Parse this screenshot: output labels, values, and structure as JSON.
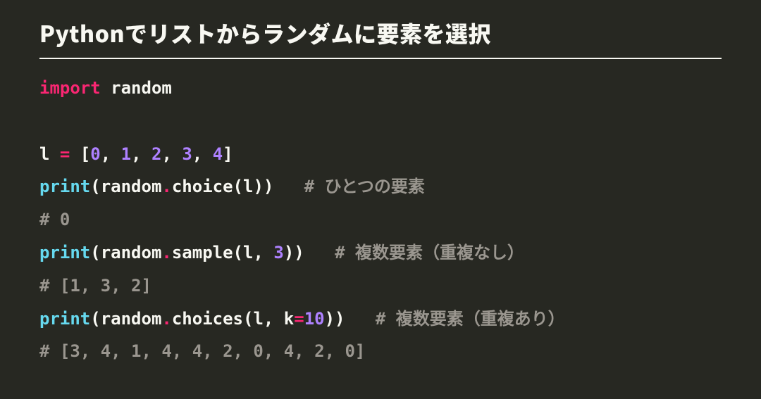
{
  "title": "Pythonでリストからランダムに要素を選択",
  "code": {
    "lines": [
      {
        "type": "tokens",
        "tokens": [
          {
            "cls": "tok-kw",
            "t": "import"
          },
          {
            "cls": "tok-txt",
            "t": " random"
          }
        ]
      },
      {
        "type": "blank"
      },
      {
        "type": "tokens",
        "tokens": [
          {
            "cls": "tok-txt",
            "t": "l "
          },
          {
            "cls": "tok-op",
            "t": "="
          },
          {
            "cls": "tok-txt",
            "t": " ["
          },
          {
            "cls": "tok-num",
            "t": "0"
          },
          {
            "cls": "tok-txt",
            "t": ", "
          },
          {
            "cls": "tok-num",
            "t": "1"
          },
          {
            "cls": "tok-txt",
            "t": ", "
          },
          {
            "cls": "tok-num",
            "t": "2"
          },
          {
            "cls": "tok-txt",
            "t": ", "
          },
          {
            "cls": "tok-num",
            "t": "3"
          },
          {
            "cls": "tok-txt",
            "t": ", "
          },
          {
            "cls": "tok-num",
            "t": "4"
          },
          {
            "cls": "tok-txt",
            "t": "]"
          }
        ]
      },
      {
        "type": "tokens",
        "tokens": [
          {
            "cls": "tok-nb",
            "t": "print"
          },
          {
            "cls": "tok-txt",
            "t": "(random"
          },
          {
            "cls": "tok-op",
            "t": "."
          },
          {
            "cls": "tok-txt",
            "t": "choice(l))   "
          },
          {
            "cls": "tok-cmt",
            "t": "# ひとつの要素"
          }
        ]
      },
      {
        "type": "tokens",
        "tokens": [
          {
            "cls": "tok-cmt",
            "t": "# 0"
          }
        ]
      },
      {
        "type": "tokens",
        "tokens": [
          {
            "cls": "tok-nb",
            "t": "print"
          },
          {
            "cls": "tok-txt",
            "t": "(random"
          },
          {
            "cls": "tok-op",
            "t": "."
          },
          {
            "cls": "tok-txt",
            "t": "sample(l, "
          },
          {
            "cls": "tok-num",
            "t": "3"
          },
          {
            "cls": "tok-txt",
            "t": "))   "
          },
          {
            "cls": "tok-cmt",
            "t": "# 複数要素（重複なし）"
          }
        ]
      },
      {
        "type": "tokens",
        "tokens": [
          {
            "cls": "tok-cmt",
            "t": "# [1, 3, 2]"
          }
        ]
      },
      {
        "type": "tokens",
        "tokens": [
          {
            "cls": "tok-nb",
            "t": "print"
          },
          {
            "cls": "tok-txt",
            "t": "(random"
          },
          {
            "cls": "tok-op",
            "t": "."
          },
          {
            "cls": "tok-txt",
            "t": "choices(l, k"
          },
          {
            "cls": "tok-op",
            "t": "="
          },
          {
            "cls": "tok-num",
            "t": "10"
          },
          {
            "cls": "tok-txt",
            "t": "))   "
          },
          {
            "cls": "tok-cmt",
            "t": "# 複数要素（重複あり）"
          }
        ]
      },
      {
        "type": "tokens",
        "tokens": [
          {
            "cls": "tok-cmt",
            "t": "# [3, 4, 1, 4, 4, 2, 0, 4, 2, 0]"
          }
        ]
      }
    ]
  }
}
